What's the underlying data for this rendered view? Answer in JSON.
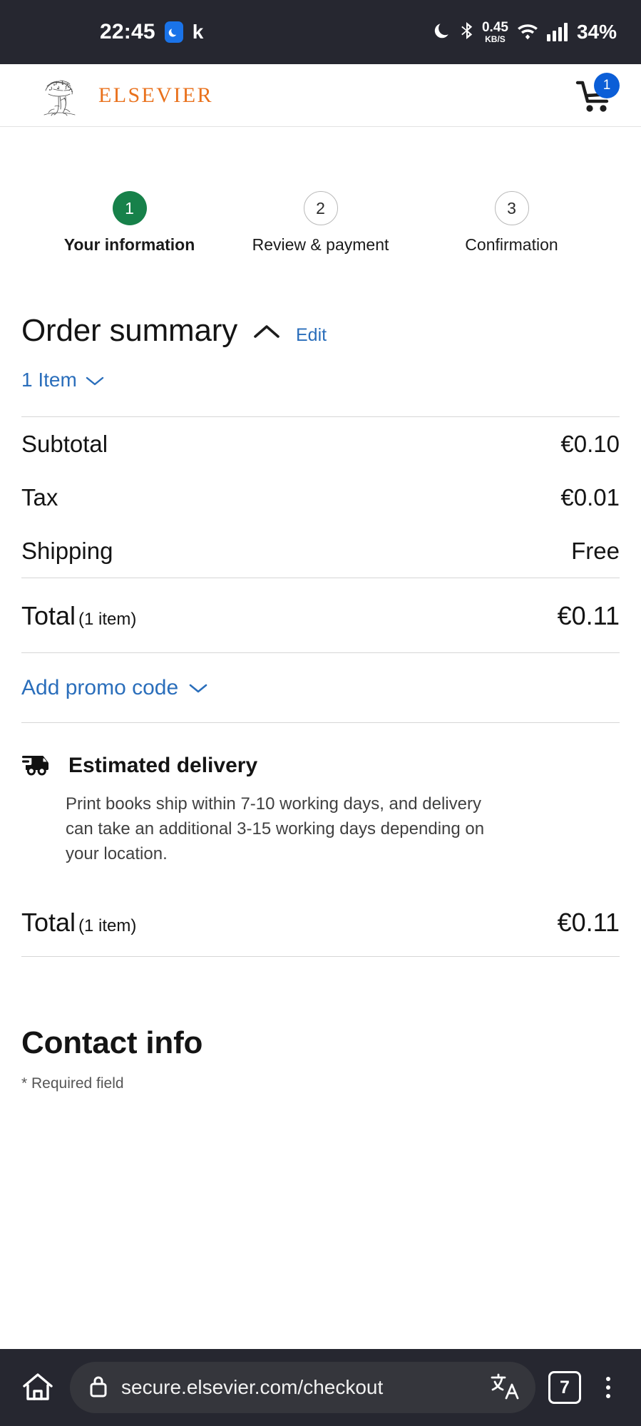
{
  "status_bar": {
    "time": "22:45",
    "app_chip_icon": "moon-chip-icon",
    "app_letter": "k",
    "dnd_icon": "crescent-moon-icon",
    "bluetooth_icon": "bluetooth-icon",
    "net_speed_value": "0.45",
    "net_speed_unit": "KB/S",
    "wifi_icon": "wifi-icon",
    "signal_icon": "signal-bars-icon",
    "battery": "34%",
    "bg_color": "#262730"
  },
  "header": {
    "logo_icon": "elsevier-tree-logo-icon",
    "brand_name": "ELSEVIER",
    "brand_color": "#e9711c",
    "cart_icon": "shopping-cart-icon",
    "cart_count": "1",
    "cart_badge_color": "#0b5ed7"
  },
  "stepper": {
    "steps": [
      {
        "number": "1",
        "label": "Your information",
        "state": "active"
      },
      {
        "number": "2",
        "label": "Review & payment",
        "state": "idle"
      },
      {
        "number": "3",
        "label": "Confirmation",
        "state": "idle"
      }
    ],
    "active_color": "#17814a"
  },
  "order_summary": {
    "title": "Order summary",
    "collapse_icon": "chevron-up-icon",
    "edit_label": "Edit",
    "items_toggle_label": "1 Item",
    "items_toggle_icon": "chevron-down-icon",
    "rows": [
      {
        "label": "Subtotal",
        "value": "€0.10"
      },
      {
        "label": "Tax",
        "value": "€0.01"
      },
      {
        "label": "Shipping",
        "value": "Free"
      }
    ],
    "total": {
      "label": "Total",
      "count": "(1 item)",
      "value": "€0.11"
    },
    "promo": {
      "label": "Add promo code",
      "icon": "chevron-down-icon"
    },
    "link_color": "#2a6ebb"
  },
  "delivery": {
    "icon": "delivery-truck-icon",
    "title": "Estimated delivery",
    "text": "Print books ship within 7-10 working days, and delivery can take an additional 3-15 working days depending on your location."
  },
  "grand_total": {
    "label": "Total",
    "count": "(1 item)",
    "value": "€0.11"
  },
  "contact": {
    "title": "Contact info",
    "required_note": "* Required field"
  },
  "browser_bar": {
    "home_icon": "home-icon",
    "lock_icon": "lock-icon",
    "url": "secure.elsevier.com/checkout",
    "translate_icon": "translate-icon",
    "tab_count": "7",
    "menu_icon": "kebab-menu-icon",
    "bg_color": "#262730"
  }
}
